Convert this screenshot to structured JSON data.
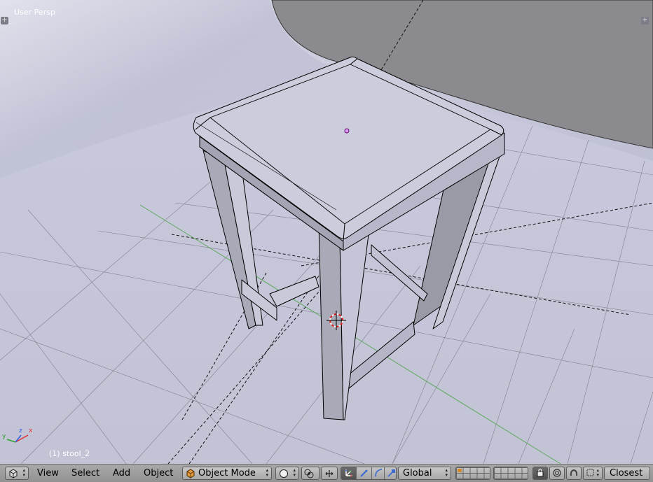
{
  "viewport": {
    "view_label": "User Persp",
    "object_label": "(1) stool_2",
    "axis_labels": {
      "x": "x",
      "y": "y",
      "z": "z"
    },
    "colors": {
      "grid_x_axis": "#5fa85f",
      "background": "#c5c6d8",
      "wire": "#000000",
      "origin": "#b000b0",
      "cursor": "#e02020"
    }
  },
  "header": {
    "editor_type_icon": "3d-view-cube-icon",
    "menus": [
      "View",
      "Select",
      "Add",
      "Object"
    ],
    "mode": "Object Mode",
    "viewport_shading_icon": "sphere-shading-icon",
    "pivot_icon": "pivot-point-icon",
    "transform_orientation": "Global",
    "snap_target": "Closest"
  }
}
